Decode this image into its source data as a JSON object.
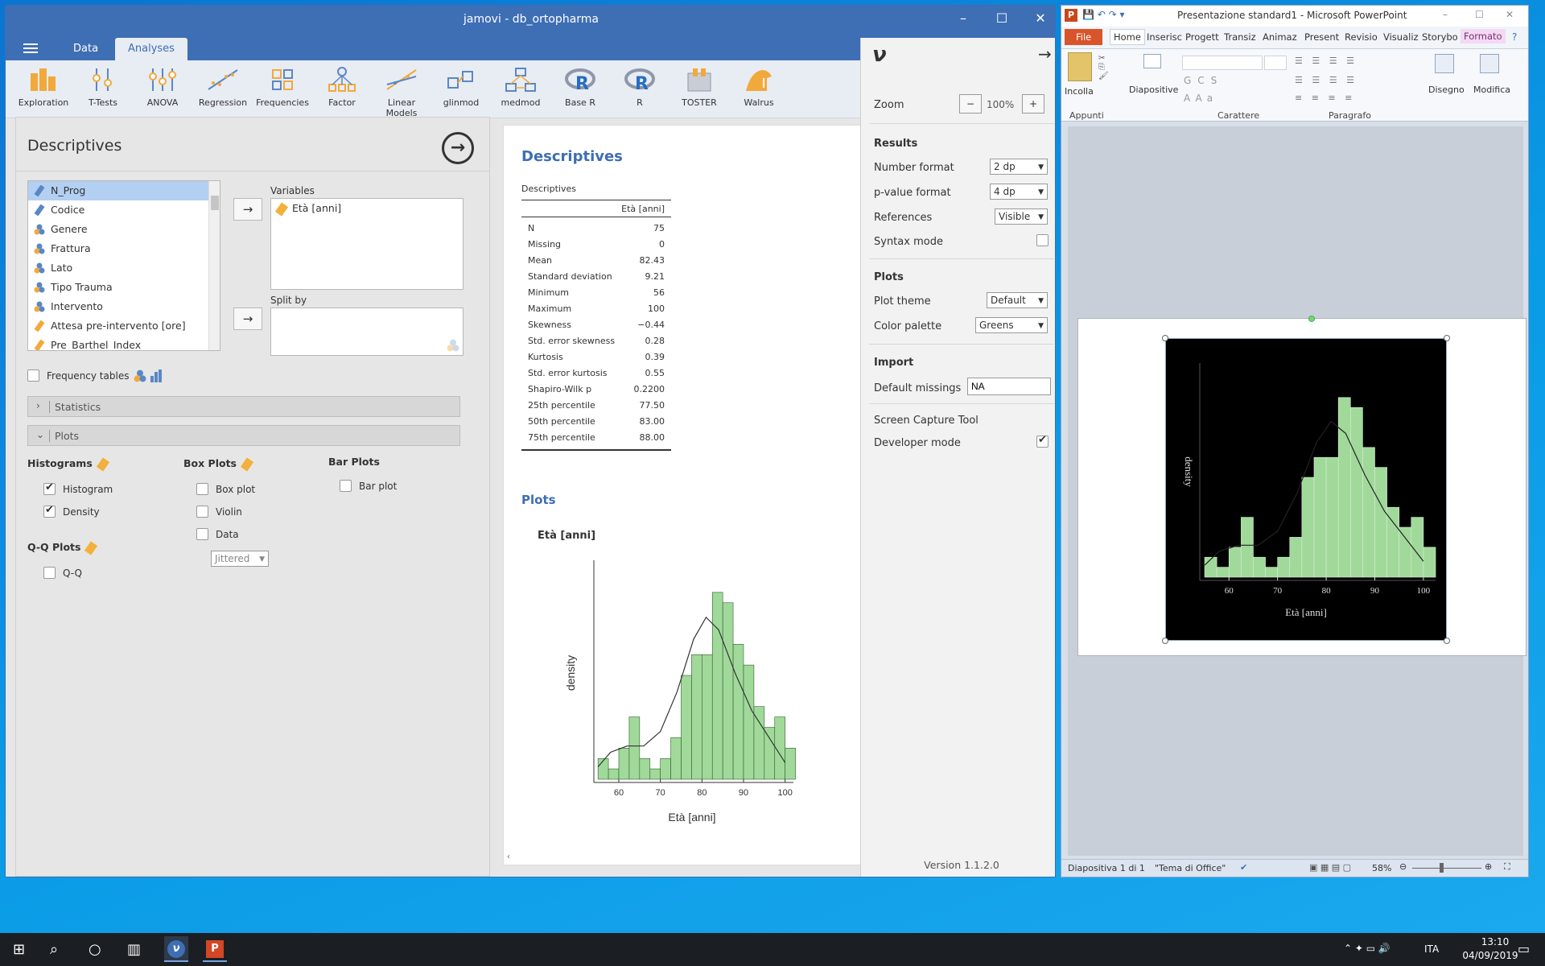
{
  "jamovi": {
    "window_title": "jamovi - db_ortopharma",
    "tabs": [
      "Data",
      "Analyses"
    ],
    "ribbon": [
      "Exploration",
      "T-Tests",
      "ANOVA",
      "Regression",
      "Frequencies",
      "Factor",
      "Linear Models",
      "glinmod",
      "medmod",
      "Base R",
      "R",
      "TOSTER",
      "Walrus"
    ],
    "options": {
      "title": "Descriptives",
      "variables": [
        "N_Prog",
        "Codice",
        "Genere",
        "Frattura",
        "Lato",
        "Tipo Trauma",
        "Intervento",
        "Attesa pre-intervento [ore]",
        "Pre_Barthel_Index"
      ],
      "variables_label": "Variables",
      "selected_variable": "Età [anni]",
      "split_label": "Split by",
      "freq_tables": "Frequency tables",
      "statistics": "Statistics",
      "plots": "Plots",
      "histograms": "Histograms",
      "histogram": "Histogram",
      "density": "Density",
      "box_plots": "Box Plots",
      "box_plot": "Box plot",
      "violin": "Violin",
      "data": "Data",
      "jittered": "Jittered",
      "bar_plots": "Bar Plots",
      "bar_plot": "Bar plot",
      "qq_plots": "Q-Q Plots",
      "qq": "Q-Q"
    },
    "results": {
      "title": "Descriptives",
      "table_title": "Descriptives",
      "column": "Età [anni]",
      "rows": [
        [
          "N",
          "75"
        ],
        [
          "Missing",
          "0"
        ],
        [
          "Mean",
          "82.43"
        ],
        [
          "Standard deviation",
          "9.21"
        ],
        [
          "Minimum",
          "56"
        ],
        [
          "Maximum",
          "100"
        ],
        [
          "Skewness",
          "−0.44"
        ],
        [
          "Std. error skewness",
          "0.28"
        ],
        [
          "Kurtosis",
          "0.39"
        ],
        [
          "Std. error kurtosis",
          "0.55"
        ],
        [
          "Shapiro-Wilk p",
          "0.2200"
        ],
        [
          "25th percentile",
          "77.50"
        ],
        [
          "50th percentile",
          "83.00"
        ],
        [
          "75th percentile",
          "88.00"
        ]
      ],
      "plots_title": "Plots",
      "plot_title": "Età [anni]"
    },
    "settings": {
      "zoom_label": "Zoom",
      "zoom_value": "100%",
      "zoom_minus": "−",
      "zoom_plus": "+",
      "results_h": "Results",
      "number_format": "Number format",
      "number_format_v": "2 dp",
      "pvalue_format": "p-value format",
      "pvalue_format_v": "4 dp",
      "references": "References",
      "references_v": "Visible",
      "syntax_mode": "Syntax mode",
      "plots_h": "Plots",
      "plot_theme": "Plot theme",
      "plot_theme_v": "Default",
      "color_palette": "Color palette",
      "color_palette_v": "Greens",
      "import_h": "Import",
      "default_missings": "Default missings",
      "default_missings_v": "NA",
      "screen_capture": "Screen Capture Tool",
      "developer_mode": "Developer mode",
      "version": "Version 1.1.2.0"
    }
  },
  "powerpoint": {
    "window_title": "Presentazione standard1 - Microsoft PowerPoint",
    "tabs": [
      "File",
      "Home",
      "Inserisc",
      "Progett",
      "Transiz",
      "Animaz",
      "Present",
      "Revisio",
      "Visualiz",
      "Storybo",
      "Formato"
    ],
    "groups": [
      "Appunti",
      "Carattere",
      "Paragrafo"
    ],
    "buttons": {
      "paste": "Incolla",
      "slides": "Diapositive",
      "draw": "Disegno",
      "edit": "Modifica"
    },
    "status": {
      "slide": "Diapositiva 1 di 1",
      "theme": "\"Tema di Office\"",
      "zoom": "58%"
    }
  },
  "taskbar": {
    "lang": "ITA",
    "time": "13:10",
    "date": "04/09/2019"
  },
  "chart_data": {
    "type": "bar",
    "xlabel": "Età [anni]",
    "ylabel": "density",
    "xlim": [
      54,
      102
    ],
    "xticks": [
      60,
      70,
      80,
      90,
      100
    ],
    "bins": [
      55,
      57.5,
      60,
      62.5,
      65,
      67.5,
      70,
      72.5,
      75,
      77.5,
      80,
      82.5,
      85,
      87.5,
      90,
      92.5,
      95,
      97.5,
      100
    ],
    "values": [
      2,
      1,
      3,
      6,
      2,
      1,
      2,
      4,
      10,
      12,
      12,
      18,
      17,
      13,
      11,
      7,
      5,
      6,
      3
    ],
    "density_curve": [
      [
        55,
        1.2
      ],
      [
        58,
        2.6
      ],
      [
        62,
        3.2
      ],
      [
        66,
        3.2
      ],
      [
        70,
        4.6
      ],
      [
        74,
        8.4
      ],
      [
        78,
        13.5
      ],
      [
        81,
        15.6
      ],
      [
        84,
        14.4
      ],
      [
        88,
        10.2
      ],
      [
        92,
        6.6
      ],
      [
        96,
        4.1
      ],
      [
        100,
        1.6
      ]
    ]
  }
}
